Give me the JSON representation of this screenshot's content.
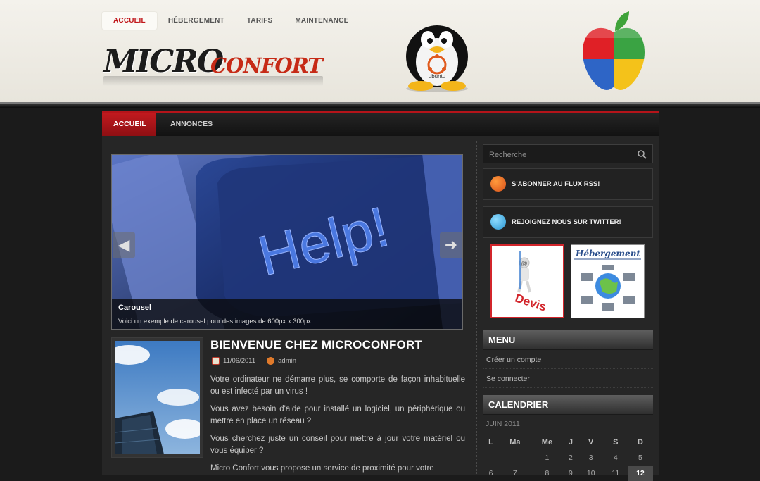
{
  "top_nav": {
    "items": [
      {
        "label": "ACCUEIL",
        "active": true
      },
      {
        "label": "HÉBERGEMENT",
        "active": false
      },
      {
        "label": "TARIFS",
        "active": false
      },
      {
        "label": "MAINTENANCE",
        "active": false
      }
    ]
  },
  "logo": {
    "part1": "MICRO",
    "part2": "CONFORT",
    "tux_text": "ubuntu"
  },
  "main_nav": {
    "items": [
      {
        "label": "ACCUEIL",
        "active": true
      },
      {
        "label": "ANNONCES",
        "active": false
      }
    ]
  },
  "carousel": {
    "image_text": "Help!",
    "caption_title": "Carousel",
    "caption_text": "Voici un exemple de carousel pour des images de 600px x 300px",
    "prev_icon": "arrow-left-icon",
    "next_icon": "arrow-right-icon"
  },
  "post": {
    "title": "BIENVENUE CHEZ MICROCONFORT",
    "date": "11/06/2011",
    "author": "admin",
    "paragraphs": [
      "Votre ordinateur ne démarre plus, se comporte de façon inhabituelle ou est infecté par un virus !",
      "Vous avez besoin d'aide pour installé un logiciel, un périphérique ou mettre en place un réseau ?",
      "Vous cherchez juste un conseil pour mettre à jour votre matériel ou vous équiper ?",
      "Micro Confort vous propose un service de proximité pour votre"
    ]
  },
  "sidebar": {
    "search_placeholder": "Recherche",
    "rss_label": "S'ABONNER AU FLUX RSS!",
    "twitter_label": "REJOIGNEZ NOUS SUR TWITTER!",
    "banner_devis": "Devis",
    "banner_heberg": "Hébergement",
    "menu_title": "MENU",
    "menu_links": [
      "Créer un compte",
      "Se connecter"
    ],
    "calendar_title": "CALENDRIER",
    "calendar": {
      "caption": "JUIN 2011",
      "weekdays": [
        "L",
        "Ma",
        "Me",
        "J",
        "V",
        "S",
        "D"
      ],
      "rows": [
        [
          "",
          "",
          "1",
          "2",
          "3",
          "4",
          "5"
        ],
        [
          "6",
          "7",
          "8",
          "9",
          "10",
          "11",
          "12"
        ]
      ],
      "today": "12"
    }
  },
  "colors": {
    "accent_red": "#c21a1f",
    "background": "#1b1b1b",
    "header_bg": "#f0eee7"
  }
}
